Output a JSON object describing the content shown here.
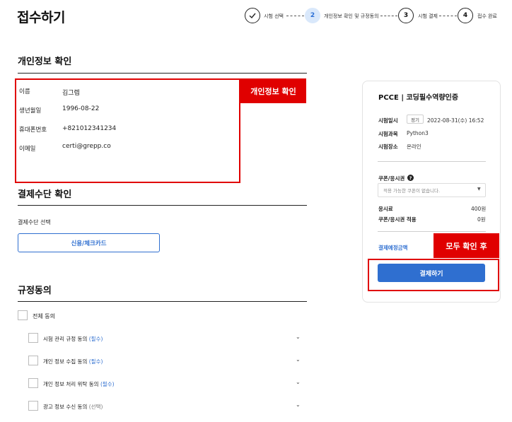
{
  "page": {
    "title": "접수하기"
  },
  "steps": [
    {
      "number": "",
      "label": "시험 선택",
      "state": "done"
    },
    {
      "number": "2",
      "label": "개인정보 확인 및 규정동의",
      "state": "active"
    },
    {
      "number": "3",
      "label": "시험 결제",
      "state": "todo"
    },
    {
      "number": "4",
      "label": "접수 완료",
      "state": "todo"
    }
  ],
  "personal": {
    "title": "개인정보 확인",
    "annotation": "개인정보 확인",
    "rows": [
      {
        "label": "이름",
        "value": "김그렙"
      },
      {
        "label": "생년월일",
        "value": "1996-08-22"
      },
      {
        "label": "휴대폰번호",
        "value": "+821012341234"
      },
      {
        "label": "이메일",
        "value": "certi@grepp.co"
      }
    ]
  },
  "payment": {
    "title": "결제수단 확인",
    "select_label": "결제수단 선택",
    "method_button": "신용/체크카드"
  },
  "terms": {
    "title": "규정동의",
    "all_label": "전체 동의",
    "items": [
      {
        "label": "시험 관리 규정 동의",
        "tag": "(필수)",
        "kind": "req"
      },
      {
        "label": "개인 정보 수집 동의",
        "tag": "(필수)",
        "kind": "req"
      },
      {
        "label": "개인 정보 처리 위탁 동의",
        "tag": "(필수)",
        "kind": "req"
      },
      {
        "label": "광고 정보 수신 동의",
        "tag": "(선택)",
        "kind": "opt"
      }
    ]
  },
  "summary": {
    "title": "PCCE | 코딩필수역량인증",
    "rows": [
      {
        "label": "시험일시",
        "badge": "정기",
        "value": "2022-08-31(수) 16:52"
      },
      {
        "label": "시험과목",
        "value": "Python3"
      },
      {
        "label": "시험장소",
        "value": "온라인"
      }
    ],
    "coupon_label": "쿠폰/응시권",
    "coupon_placeholder": "적용 가능한 쿠폰이 없습니다.",
    "fee_label": "응시료",
    "fee_value": "400원",
    "discount_label": "쿠폰/응시권 적용",
    "discount_value": "0원",
    "total_label": "결제예정금액",
    "annotation": "모두 확인 후",
    "pay_button": "결제하기"
  },
  "colors": {
    "accent": "#2f6fd0",
    "annotation": "#e00000",
    "active_step_bg": "#d9e8fb"
  }
}
